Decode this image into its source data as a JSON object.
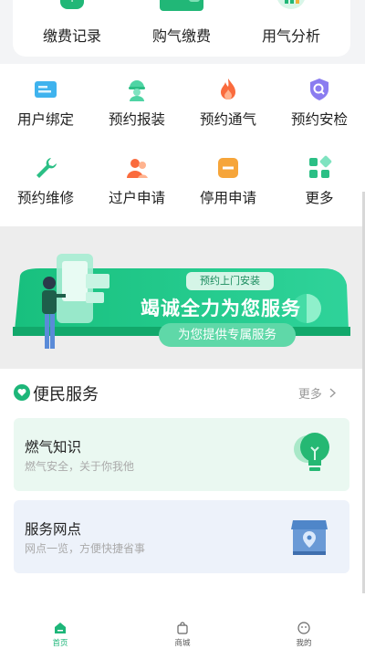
{
  "top_items": [
    {
      "label": "缴费记录",
      "icon": "bill-record-icon"
    },
    {
      "label": "购气缴费",
      "icon": "wallet-icon"
    },
    {
      "label": "用气分析",
      "icon": "analysis-icon"
    }
  ],
  "grid": [
    {
      "label": "用户绑定",
      "icon": "id-card-icon"
    },
    {
      "label": "预约报装",
      "icon": "worker-icon"
    },
    {
      "label": "预约通气",
      "icon": "flame-icon"
    },
    {
      "label": "预约安检",
      "icon": "shield-search-icon"
    },
    {
      "label": "预约维修",
      "icon": "wrench-icon"
    },
    {
      "label": "过户申请",
      "icon": "transfer-user-icon"
    },
    {
      "label": "停用申请",
      "icon": "stop-icon"
    },
    {
      "label": "更多",
      "icon": "apps-icon"
    }
  ],
  "banner": {
    "tag": "预约上门安装",
    "title": "竭诚全力为您服务",
    "subtitle": "为您提供专属服务"
  },
  "convenience": {
    "title": "便民服务",
    "more": "更多",
    "cards": [
      {
        "title": "燃气知识",
        "subtitle": "燃气安全，关于你我他",
        "icon": "lightbulb-icon"
      },
      {
        "title": "服务网点",
        "subtitle": "网点一览，方便快捷省事",
        "icon": "store-location-icon"
      }
    ]
  },
  "tabbar": [
    {
      "label": "首页",
      "icon": "home-icon",
      "active": true
    },
    {
      "label": "商城",
      "icon": "bag-icon",
      "active": false
    },
    {
      "label": "我的",
      "icon": "profile-icon",
      "active": false
    }
  ],
  "colors": {
    "accent": "#1db679",
    "accent_light": "#5fd8a8"
  }
}
